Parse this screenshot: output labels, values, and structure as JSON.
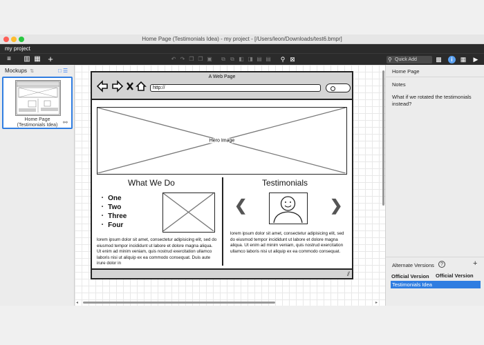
{
  "window": {
    "title": "Home Page (Testimonials Idea) - my project - [/Users/leon/Downloads/test6.bmpr]",
    "project_name": "my project"
  },
  "toolbar": {
    "quick_add_placeholder": "Quick Add"
  },
  "mockups_panel": {
    "title": "Mockups",
    "items": [
      {
        "label": "Home Page\n(Testimonials Idea)"
      }
    ]
  },
  "mockup": {
    "page_title": "A Web Page",
    "url": "http://",
    "hero_label": "Hero Image",
    "what_we_do": {
      "title": "What We Do",
      "items": [
        "One",
        "Two",
        "Three",
        "Four"
      ],
      "body": "lorem ipsum dolor sit amet, consectetur adipisicing elit, sed do eiusmod tempor incididunt ut labore et dolore magna aliqua. Ut enim ad minim veniam, quis nostrud exercitation ullamco laboris nisi ut aliquip ex ea commodo consequat. Duis aute irure dolor in"
    },
    "testimonials": {
      "title": "Testimonials",
      "body": "lorem ipsum dolor sit amet, consectetur adipisicing elit, sed do eiusmod tempor incididunt ut labore et dolore magna aliqua. Ut enim ad minim veniam, quis nostrud exercitation ullamco laboris nisi ut aliquip ex ea commodo consequat."
    }
  },
  "inspector": {
    "mockup_name": "Home Page",
    "notes_label": "Notes",
    "notes_text": "What if we rotated the testimonials instead?",
    "alternate_versions_label": "Alternate Versions",
    "help_symbol": "?",
    "add_symbol": "+",
    "versions": [
      "Official Version",
      "Testimonials Idea"
    ]
  },
  "colors": {
    "accent": "#2f7de1",
    "dark_bar": "#2b2b2b"
  }
}
